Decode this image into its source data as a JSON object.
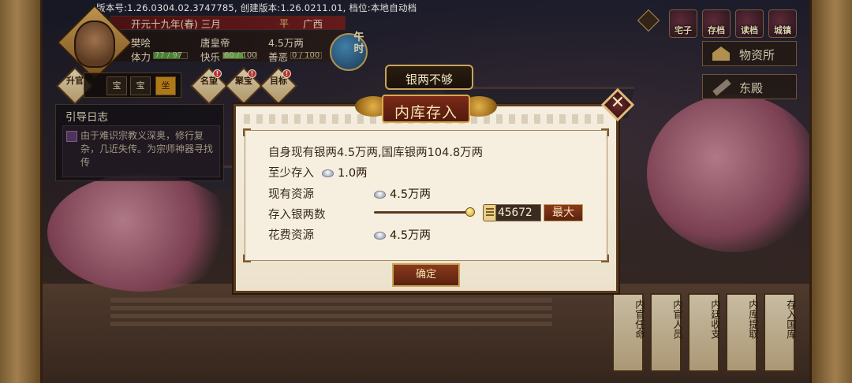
{
  "status": {
    "version_line": "版本号:1.26.0304.02.3747785, 创建版本:1.26.0211.01, 档位:本地自动档"
  },
  "character": {
    "date": "开元十九年(春) 三月",
    "region": "广西",
    "region_icon": "平",
    "name": "樊哙",
    "emperor": "唐皇帝",
    "silver": "4.5万两",
    "stamina_label": "体力",
    "stamina_value": "77 / 97",
    "stamina_ratio": 0.79,
    "happiness_label": "快乐",
    "happiness_value": "60 / 100",
    "happiness_ratio": 0.6,
    "karma_label": "善恶",
    "karma_value": "0 / 100",
    "karma_ratio": 0.0,
    "time_badge": "午时"
  },
  "actions": [
    {
      "label": "升官",
      "icon": "promote-icon",
      "badge": ""
    },
    {
      "label": "名望",
      "icon": "fame-icon",
      "badge": "!"
    },
    {
      "label": "聚宝",
      "icon": "treasure-icon",
      "badge": "!"
    },
    {
      "label": "目标",
      "icon": "goal-icon",
      "badge": "!"
    }
  ],
  "chips": [
    "宝",
    "宝",
    "坐"
  ],
  "guide": {
    "title": "引导日志",
    "text": "由于难识宗教义深奥，修行复杂，几近失传。为宗师神器寻找传"
  },
  "top_menu": [
    {
      "label": "宅子",
      "icon": "house-icon"
    },
    {
      "label": "存档",
      "icon": "save-icon"
    },
    {
      "label": "读档",
      "icon": "load-icon"
    },
    {
      "label": "城镇",
      "icon": "town-icon"
    }
  ],
  "side_buttons": [
    {
      "label": "物资所",
      "icon": "warehouse-icon"
    },
    {
      "label": "东殿",
      "icon": "hall-icon"
    }
  ],
  "bottom_tabs": [
    "内官任命",
    "内官人员",
    "内廷收支",
    "内库提取",
    "存入国库"
  ],
  "toast": "银两不够",
  "dialog": {
    "title": "内库存入",
    "summary": "自身现有银两4.5万两,国库银两104.8万两",
    "min_label": "至少存入",
    "min_value": "1.0两",
    "resource_label": "现有资源",
    "resource_value": "4.5万两",
    "deposit_label": "存入银两数",
    "deposit_input": "45672",
    "slider_ratio": 1.0,
    "max_button": "最大",
    "cost_label": "花费资源",
    "cost_value": "4.5万两",
    "confirm_button": "确定"
  },
  "colors": {
    "accent_gold": "#c9a45a",
    "button_red": "#8a3a1a",
    "dialog_bg": "#f5eedf",
    "stamina_green": "#4a9a3a",
    "happiness_green": "#6ab04a",
    "text_dark": "#3a2a1a"
  }
}
